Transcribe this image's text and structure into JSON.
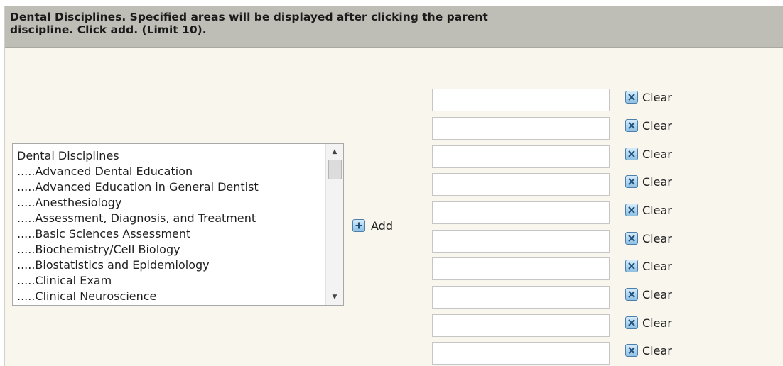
{
  "header": {
    "instructions": "Dental Disciplines. Specified areas will be displayed after clicking the parent discipline. Click add. (Limit 10)."
  },
  "discipline_list": {
    "items": [
      "Dental Disciplines",
      ".....Advanced Dental Education",
      ".....Advanced Education in General Dentist",
      ".....Anesthesiology",
      ".....Assessment, Diagnosis, and Treatment",
      ".....Basic Sciences Assessment",
      ".....Biochemistry/Cell Biology",
      ".....Biostatistics and Epidemiology",
      ".....Clinical Exam",
      ".....Clinical Neuroscience"
    ]
  },
  "add_button": {
    "label": "Add",
    "icon": "plus-icon"
  },
  "selected_fields": {
    "clear_label": "Clear",
    "clear_icon": "close-icon",
    "values": [
      "",
      "",
      "",
      "",
      "",
      "",
      "",
      "",
      "",
      ""
    ]
  },
  "colors": {
    "header_bg": "#bebdb6",
    "panel_bg": "#f9f6ee",
    "icon_accent": "#8fc0e5"
  }
}
